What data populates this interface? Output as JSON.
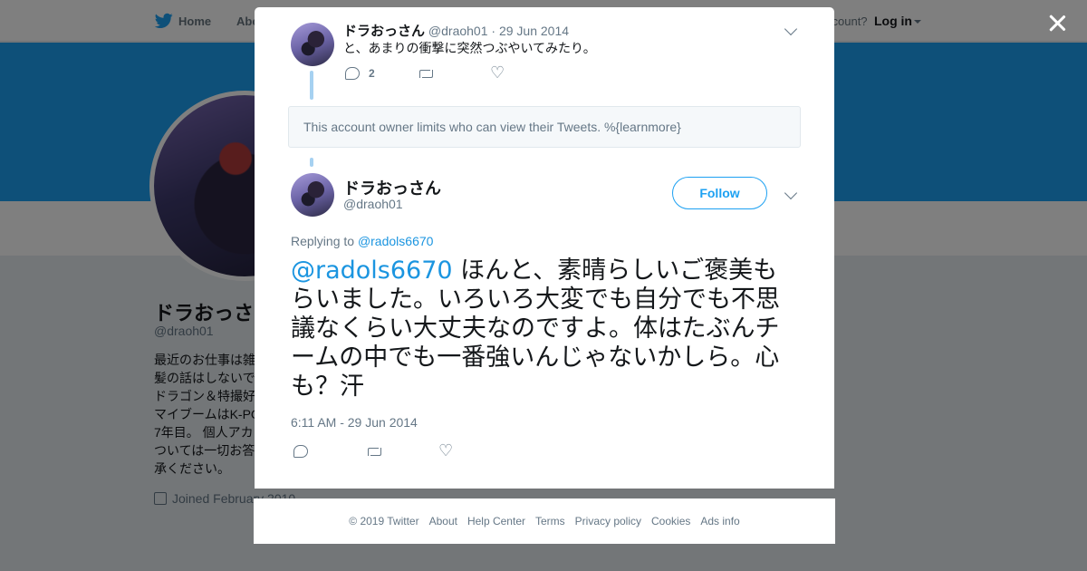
{
  "header": {
    "nav_home": "Home",
    "nav_about": "Abo",
    "account_prompt": "ccount?",
    "login_label": "Log in"
  },
  "profile": {
    "name": "ドラおっさ",
    "handle": "@draoh01",
    "bio_lines": [
      "最近のお仕事は雑",
      "髪の話はしないで",
      "ドラゴン＆特撮好",
      "マイブームはK-PO",
      "7年目。 個人アカ",
      "ついては一切お答",
      "承ください。"
    ],
    "joined": "Joined February 2010"
  },
  "ancestor_tweet": {
    "name": "ドラおっさん",
    "handle": "@draoh01",
    "separator": "·",
    "date": "29 Jun 2014",
    "text": "と、あまりの衝撃に突然つぶやいてみたり。",
    "reply_count": "2"
  },
  "notice": {
    "text": "This account owner limits who can view their Tweets. %{learnmore}"
  },
  "main_tweet": {
    "name": "ドラおっさん",
    "handle": "@draoh01",
    "follow_label": "Follow",
    "replying_prefix": "Replying to",
    "replying_to": "@radols6670",
    "mention": "@radols6670",
    "text": " ほんと、素晴らしいご褒美もらいました。いろいろ大変でも自分でも不思議なくらい大丈夫なのですよ。体はたぶんチームの中でも一番強いんじゃないかしら。心も？汗",
    "timestamp": "6:11 AM - 29 Jun 2014"
  },
  "footer": {
    "copyright": "© 2019 Twitter",
    "links": [
      "About",
      "Help Center",
      "Terms",
      "Privacy policy",
      "Cookies",
      "Ads info"
    ]
  },
  "icons": {
    "close": "close-icon",
    "reply": "reply-icon",
    "retweet": "retweet-icon",
    "like": "heart-icon",
    "more": "chevron-down-icon",
    "logo": "twitter-bird-icon"
  },
  "colors": {
    "brand": "#1da1f2",
    "link": "#1b95e0",
    "thread_line": "#a6d1f1",
    "secondary_text": "#657786"
  }
}
